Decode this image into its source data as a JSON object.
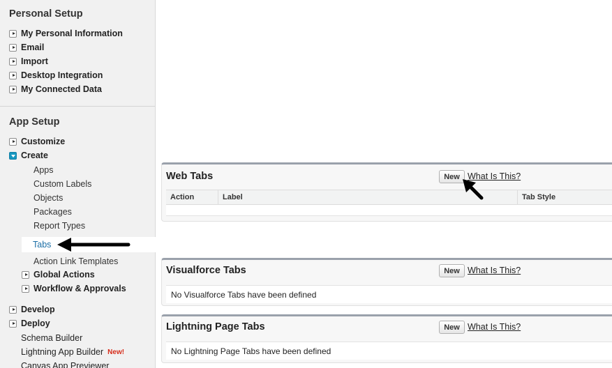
{
  "sidebar": {
    "personal_setup": {
      "title": "Personal Setup",
      "items": [
        {
          "label": "My Personal Information"
        },
        {
          "label": "Email"
        },
        {
          "label": "Import"
        },
        {
          "label": "Desktop Integration"
        },
        {
          "label": "My Connected Data"
        }
      ]
    },
    "app_setup": {
      "title": "App Setup",
      "customize": "Customize",
      "create": "Create",
      "create_items": [
        "Apps",
        "Custom Labels",
        "Objects",
        "Packages",
        "Report Types"
      ],
      "tabs_selected": "Tabs",
      "action_link_templates": "Action Link Templates",
      "global_actions": "Global Actions",
      "workflow_approvals": "Workflow & Approvals",
      "develop": "Develop",
      "deploy": "Deploy",
      "schema_builder": "Schema Builder",
      "lightning_app_builder": "Lightning App Builder",
      "new_badge": "New!",
      "canvas_app_previewer": "Canvas App Previewer"
    }
  },
  "main": {
    "web_tabs": {
      "title": "Web Tabs",
      "new_button": "New",
      "help_link": "What Is This?",
      "columns": [
        "Action",
        "Label",
        "Tab Style"
      ]
    },
    "visualforce_tabs": {
      "title": "Visualforce Tabs",
      "new_button": "New",
      "help_link": "What Is This?",
      "empty_message": "No Visualforce Tabs have been defined"
    },
    "lightning_page_tabs": {
      "title": "Lightning Page Tabs",
      "new_button": "New",
      "help_link": "What Is This?",
      "empty_message": "No Lightning Page Tabs have been defined"
    }
  },
  "colors": {
    "sidebar_bg": "#f1f1f1",
    "selected_link": "#1a6ea6",
    "expanded_toggle": "#1797c0",
    "new_badge": "#d62c1a"
  }
}
